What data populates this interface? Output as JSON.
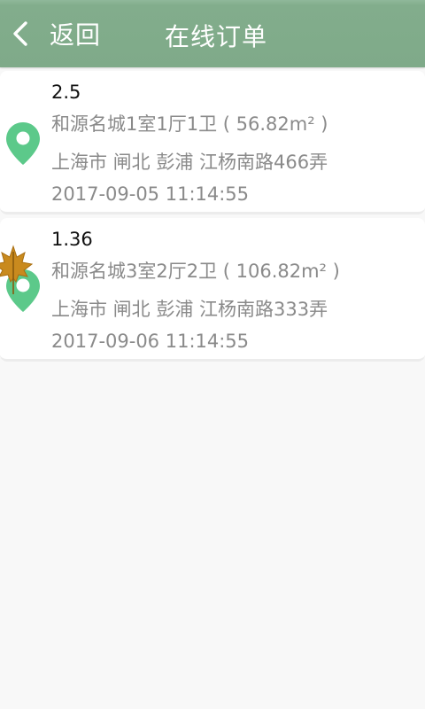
{
  "header": {
    "back_label": "返回",
    "title": "在线订单",
    "background_color": "#7faa89"
  },
  "orders": [
    {
      "price": "2.5",
      "property": "和源名城1室1厅1卫 ( 56.82m² )",
      "address": "上海市 闸北 彭浦 江杨南路466弄",
      "datetime": "2017-09-05 11:14:55"
    },
    {
      "price": "1.36",
      "property": "和源名城3室2厅2卫 ( 106.82m² )",
      "address": "上海市 闸北 彭浦 江杨南路333弄",
      "datetime": "2017-09-06 11:14:55"
    }
  ],
  "icons": {
    "location": "location-pin-icon",
    "back": "chevron-left-icon",
    "decoration": "maple-leaf-icon"
  },
  "colors": {
    "pin": "#5cc98a",
    "leaf": "#c98a1e"
  }
}
